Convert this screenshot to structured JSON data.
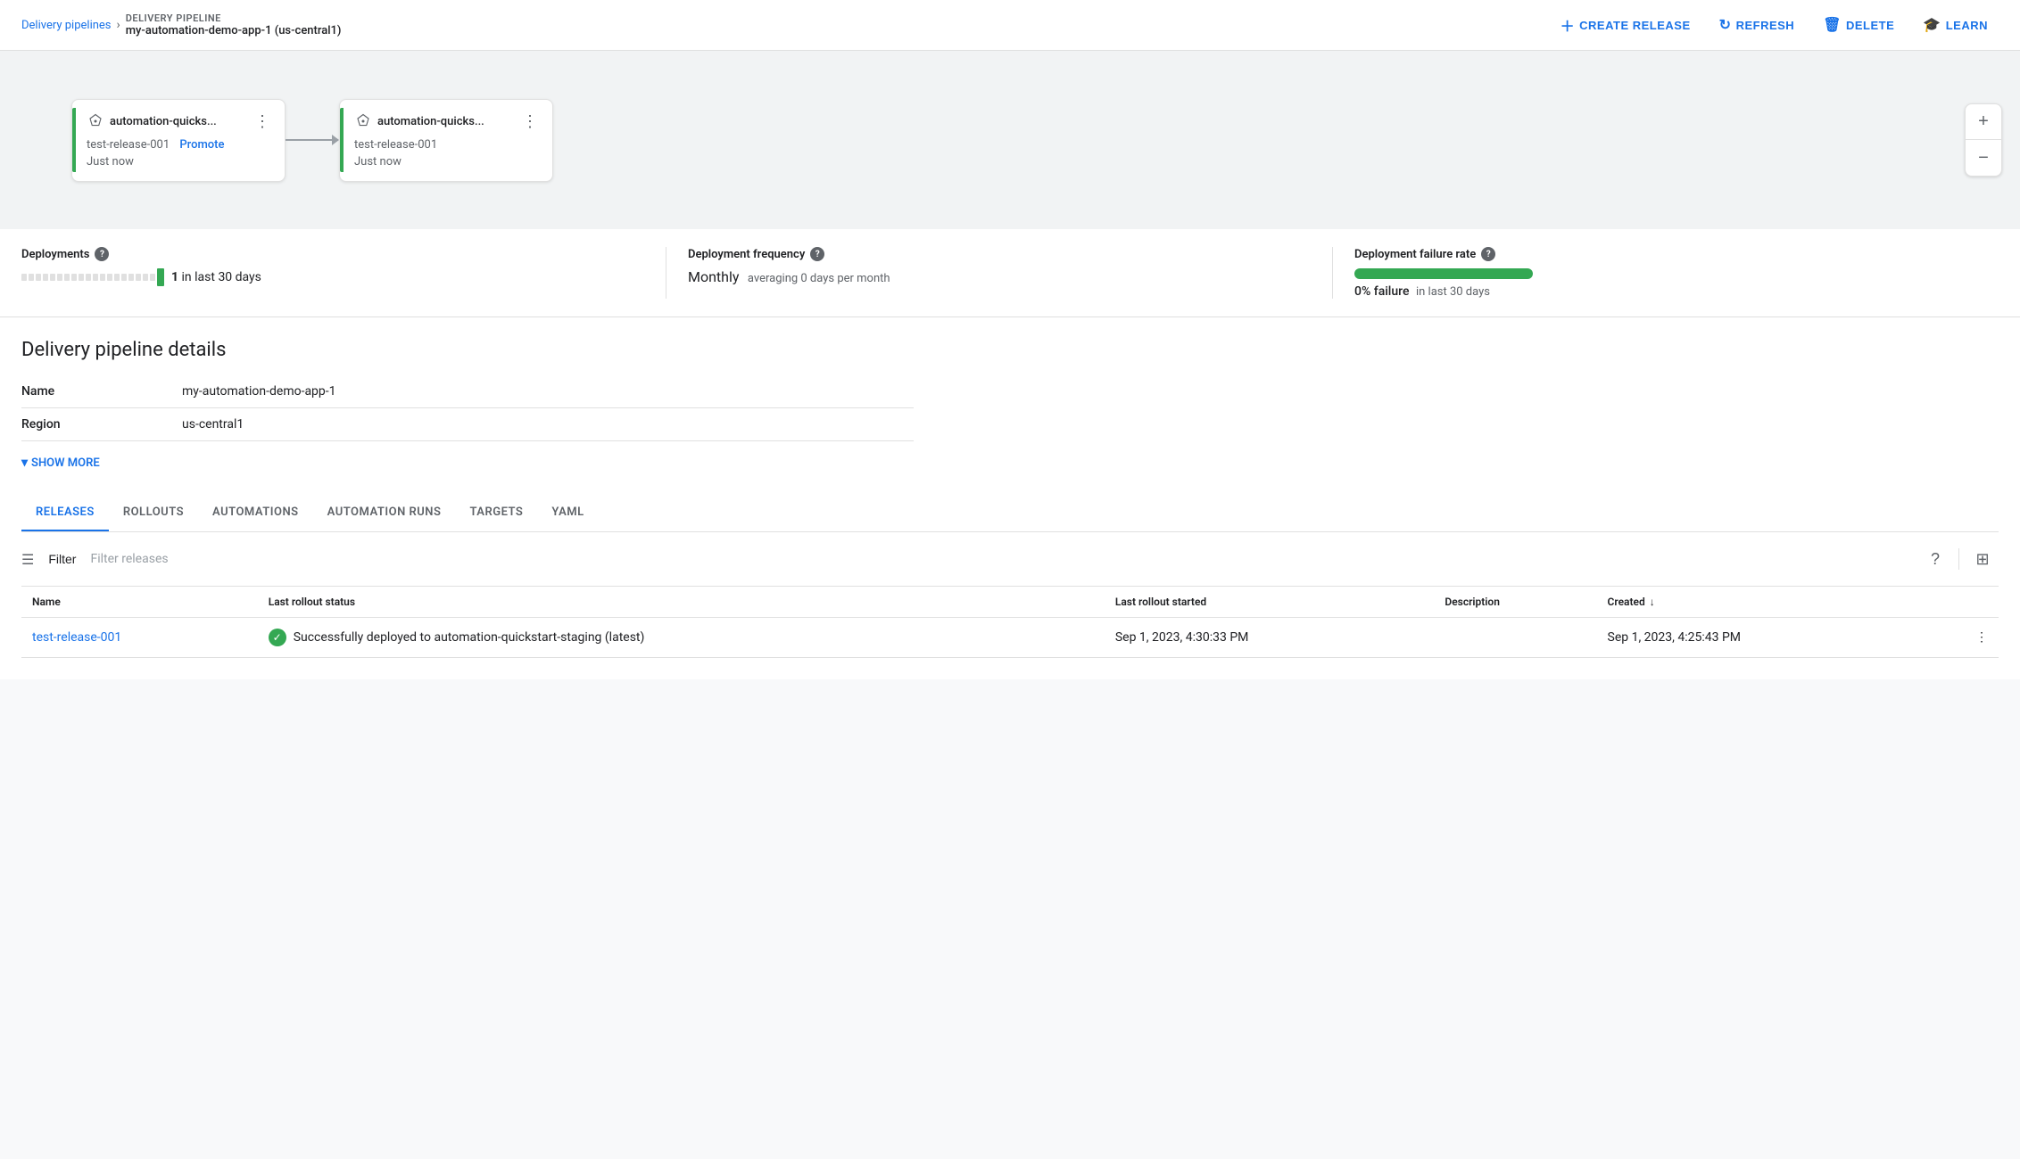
{
  "header": {
    "breadcrumb_link": "Delivery pipelines",
    "breadcrumb_sep": "›",
    "pipeline_label": "DELIVERY PIPELINE",
    "pipeline_name": "my-automation-demo-app-1 (us-central1)",
    "create_release_label": "CREATE RELEASE",
    "refresh_label": "REFRESH",
    "delete_label": "DELETE",
    "learn_label": "LEARN"
  },
  "pipeline": {
    "nodes": [
      {
        "title": "automation-quicks...",
        "release": "test-release-001",
        "promote_label": "Promote",
        "time": "Just now"
      },
      {
        "title": "automation-quicks...",
        "release": "test-release-001",
        "promote_label": null,
        "time": "Just now"
      }
    ]
  },
  "zoom": {
    "plus_label": "+",
    "minus_label": "−"
  },
  "metrics": {
    "deployments_label": "Deployments",
    "deployments_count": "1",
    "deployments_period": "in last 30 days",
    "frequency_label": "Deployment frequency",
    "frequency_value": "Monthly",
    "frequency_sub": "averaging 0 days per month",
    "failure_label": "Deployment failure rate",
    "failure_value": "0% failure",
    "failure_period": "in last 30 days"
  },
  "details": {
    "section_title": "Delivery pipeline details",
    "fields": [
      {
        "label": "Name",
        "value": "my-automation-demo-app-1"
      },
      {
        "label": "Region",
        "value": "us-central1"
      }
    ],
    "show_more_label": "SHOW MORE"
  },
  "tabs": {
    "items": [
      {
        "id": "releases",
        "label": "RELEASES",
        "active": true
      },
      {
        "id": "rollouts",
        "label": "ROLLOUTS",
        "active": false
      },
      {
        "id": "automations",
        "label": "AUTOMATIONS",
        "active": false
      },
      {
        "id": "automation-runs",
        "label": "AUTOMATION RUNS",
        "active": false
      },
      {
        "id": "targets",
        "label": "TARGETS",
        "active": false
      },
      {
        "id": "yaml",
        "label": "YAML",
        "active": false
      }
    ]
  },
  "filter": {
    "label": "Filter",
    "placeholder": "Filter releases"
  },
  "table": {
    "columns": [
      {
        "id": "name",
        "label": "Name",
        "sortable": false
      },
      {
        "id": "status",
        "label": "Last rollout status",
        "sortable": false
      },
      {
        "id": "started",
        "label": "Last rollout started",
        "sortable": false
      },
      {
        "id": "description",
        "label": "Description",
        "sortable": false
      },
      {
        "id": "created",
        "label": "Created",
        "sortable": true
      }
    ],
    "rows": [
      {
        "name": "test-release-001",
        "name_href": "#",
        "status_icon": "success",
        "status_text": "Successfully deployed to automation-quickstart-staging (latest)",
        "started": "Sep 1, 2023, 4:30:33 PM",
        "description": "",
        "created": "Sep 1, 2023, 4:25:43 PM"
      }
    ]
  }
}
